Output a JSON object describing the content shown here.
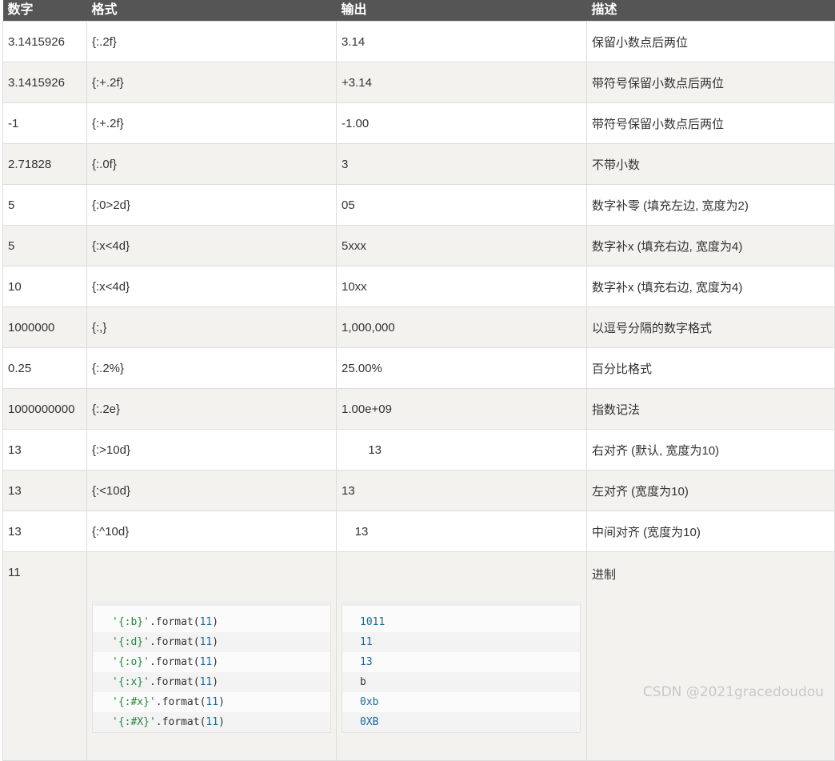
{
  "headers": [
    "数字",
    "格式",
    "输出",
    "描述"
  ],
  "rows": [
    {
      "number": "3.1415926",
      "format": "{:.2f}",
      "output": "3.14",
      "desc": "保留小数点后两位"
    },
    {
      "number": "3.1415926",
      "format": "{:+.2f}",
      "output": "+3.14",
      "desc": "带符号保留小数点后两位"
    },
    {
      "number": "-1",
      "format": "{:+.2f}",
      "output": "-1.00",
      "desc": "带符号保留小数点后两位"
    },
    {
      "number": "2.71828",
      "format": "{:.0f}",
      "output": "3",
      "desc": "不带小数"
    },
    {
      "number": "5",
      "format": "{:0>2d}",
      "output": "05",
      "desc": "数字补零 (填充左边, 宽度为2)"
    },
    {
      "number": "5",
      "format": "{:x<4d}",
      "output": "5xxx",
      "desc": "数字补x (填充右边, 宽度为4)"
    },
    {
      "number": "10",
      "format": "{:x<4d}",
      "output": "10xx",
      "desc": "数字补x (填充右边, 宽度为4)"
    },
    {
      "number": "1000000",
      "format": "{:,}",
      "output": "1,000,000",
      "desc": "以逗号分隔的数字格式"
    },
    {
      "number": "0.25",
      "format": "{:.2%}",
      "output": "25.00%",
      "desc": "百分比格式"
    },
    {
      "number": "1000000000",
      "format": "{:.2e}",
      "output": "1.00e+09",
      "desc": "指数记法"
    },
    {
      "number": "13",
      "format": "{:>10d}",
      "output": "        13",
      "desc": "右对齐 (默认, 宽度为10)"
    },
    {
      "number": "13",
      "format": "{:<10d}",
      "output": "13",
      "desc": "左对齐 (宽度为10)"
    },
    {
      "number": "13",
      "format": "{:^10d}",
      "output": "    13",
      "desc": "中间对齐 (宽度为10)"
    }
  ],
  "last_row": {
    "number": "11",
    "desc": "进制",
    "code_lines": [
      {
        "str": "'{:b}'",
        "fn": ".format(",
        "arg": "11",
        "close": ")"
      },
      {
        "str": "'{:d}'",
        "fn": ".format(",
        "arg": "11",
        "close": ")"
      },
      {
        "str": "'{:o}'",
        "fn": ".format(",
        "arg": "11",
        "close": ")"
      },
      {
        "str": "'{:x}'",
        "fn": ".format(",
        "arg": "11",
        "close": ")"
      },
      {
        "str": "'{:#x}'",
        "fn": ".format(",
        "arg": "11",
        "close": ")"
      },
      {
        "str": "'{:#X}'",
        "fn": ".format(",
        "arg": "11",
        "close": ")"
      }
    ],
    "outputs": [
      "1011",
      "11",
      "13",
      "b",
      "0xb",
      "0XB"
    ]
  },
  "watermark": "CSDN @2021gracedoudou"
}
